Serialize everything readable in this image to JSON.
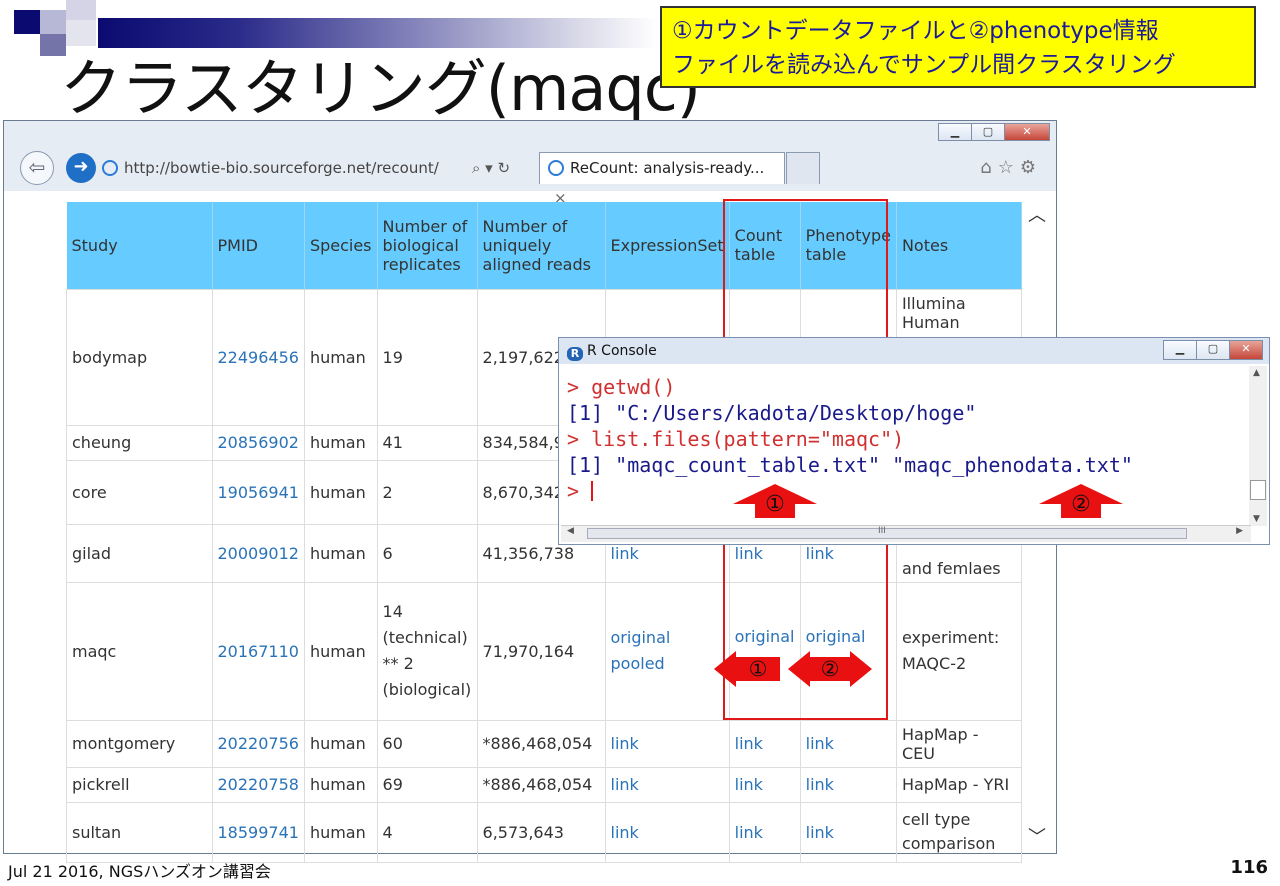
{
  "slide": {
    "title": "クラスタリング(maqc)",
    "note_line1": "①カウントデータファイルと②phenotype情報",
    "note_line2": "ファイルを読み込んでサンプル間クラスタリング",
    "footer": "Jul 21 2016, NGSハンズオン講習会",
    "page_number": "116"
  },
  "browser": {
    "address": "http://bowtie-bio.sourceforge.net/recount/",
    "tab_title": "ReCount: analysis-ready...",
    "tab_close": "×",
    "search_icons": "⌕ ▾ ↻"
  },
  "table": {
    "headers": [
      "Study",
      "PMID",
      "Species",
      "Number of biological replicates",
      "Number of uniquely aligned reads",
      "ExpressionSet",
      "Count table",
      "Phenotype table",
      "Notes"
    ],
    "rows": [
      {
        "study": "bodymap",
        "pmid": "22496456",
        "species": "human",
        "reps": "19",
        "reads": "2,197,622",
        "eset": "",
        "count": "",
        "pheno": "",
        "notes": "Illumina Human"
      },
      {
        "study": "cheung",
        "pmid": "20856902",
        "species": "human",
        "reps": "41",
        "reads": "834,584,9",
        "eset": "",
        "count": "",
        "pheno": "",
        "notes": ""
      },
      {
        "study": "core",
        "pmid": "19056941",
        "species": "human",
        "reps": "2",
        "reads": "8,670,342",
        "eset": "",
        "count": "",
        "pheno": "",
        "notes": ""
      },
      {
        "study": "gilad",
        "pmid": "20009012",
        "species": "human",
        "reps": "6",
        "reads": "41,356,738",
        "eset": "link",
        "count": "link",
        "pheno": "link",
        "notes": "and femlaes"
      },
      {
        "study": "maqc",
        "pmid": "20167110",
        "species": "human",
        "reps": "14 (technical) ** 2 (biological)",
        "reads": "71,970,164",
        "eset": "original pooled",
        "count": "original",
        "pheno": "original",
        "notes": "experiment: MAQC-2"
      },
      {
        "study": "montgomery",
        "pmid": "20220756",
        "species": "human",
        "reps": "60",
        "reads": "*886,468,054",
        "eset": "link",
        "count": "link",
        "pheno": "link",
        "notes": "HapMap - CEU"
      },
      {
        "study": "pickrell",
        "pmid": "20220758",
        "species": "human",
        "reps": "69",
        "reads": "*886,468,054",
        "eset": "link",
        "count": "link",
        "pheno": "link",
        "notes": "HapMap - YRI"
      },
      {
        "study": "sultan",
        "pmid": "18599741",
        "species": "human",
        "reps": "4",
        "reads": "6,573,643",
        "eset": "link",
        "count": "link",
        "pheno": "link",
        "notes": "cell type comparison"
      }
    ]
  },
  "rconsole": {
    "title": "R Console",
    "line1": "> getwd()",
    "line2": "[1] \"C:/Users/kadota/Desktop/hoge\"",
    "line3": "> list.files(pattern=\"maqc\")",
    "line4": "[1] \"maqc_count_table.txt\" \"maqc_phenodata.txt\"",
    "prompt": ">",
    "scroll_mark": "III"
  },
  "arrows": {
    "a1": "①",
    "a2": "②",
    "b1": "①",
    "b2": "②"
  },
  "colors": {
    "header_bg": "#66ccff",
    "link": "#2a73b8",
    "highlight": "#e01818",
    "note_bg": "#ffff00"
  }
}
